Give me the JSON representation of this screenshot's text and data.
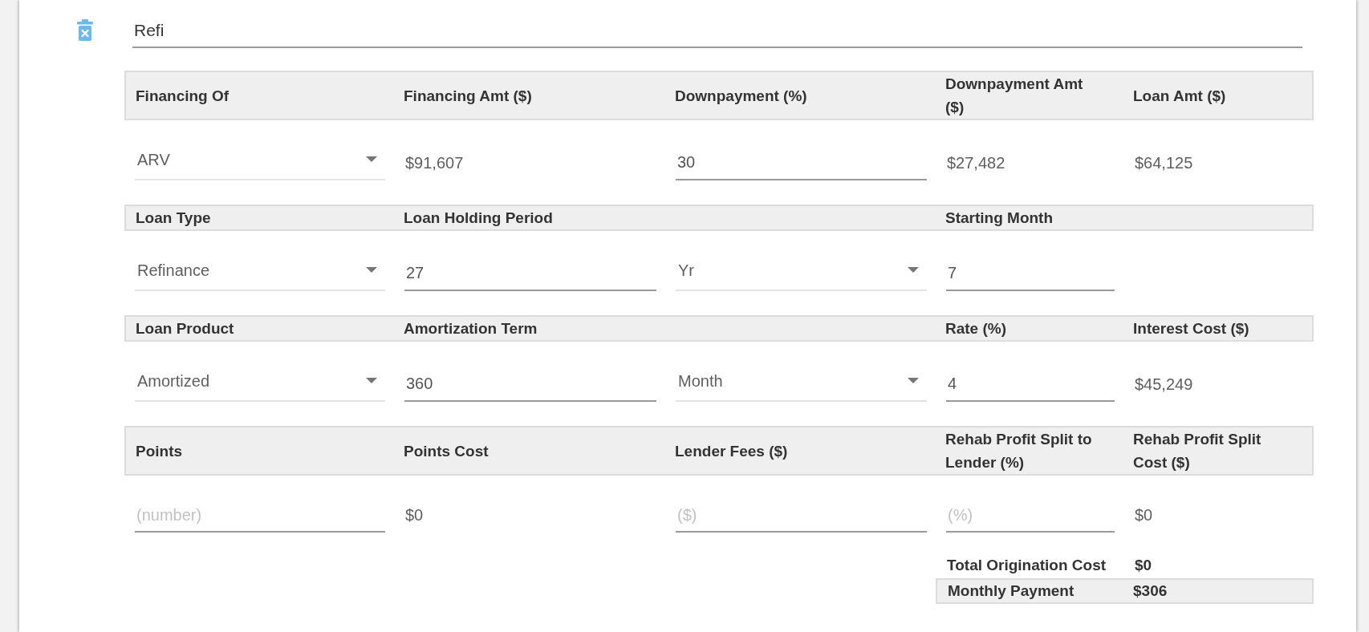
{
  "title_field": {
    "value": "Refi"
  },
  "sections": [
    {
      "cells": [
        {
          "header": "Financing Of",
          "field": {
            "kind": "select",
            "value": "ARV"
          }
        },
        {
          "header": "Financing Amt ($)",
          "field": {
            "kind": "text",
            "value": "$91,607"
          }
        },
        {
          "header": "Downpayment (%)",
          "field": {
            "kind": "input",
            "value": "30"
          }
        },
        {
          "header": "Downpayment Amt ($)",
          "field": {
            "kind": "text",
            "value": "$27,482"
          }
        },
        {
          "header": "Loan Amt ($)",
          "field": {
            "kind": "text",
            "value": "$64,125"
          }
        }
      ]
    },
    {
      "cells": [
        {
          "header": "Loan Type",
          "field": {
            "kind": "select",
            "value": "Refinance"
          }
        },
        {
          "header": "Loan Holding Period",
          "field": {
            "kind": "input",
            "value": "27"
          }
        },
        {
          "field": {
            "kind": "select",
            "value": "Yr"
          }
        },
        {
          "header": "Starting Month",
          "field": {
            "kind": "input",
            "value": "7"
          }
        }
      ]
    },
    {
      "cells": [
        {
          "header": "Loan Product",
          "field": {
            "kind": "select",
            "value": "Amortized"
          }
        },
        {
          "header": "Amortization Term",
          "field": {
            "kind": "input",
            "value": "360"
          }
        },
        {
          "field": {
            "kind": "select",
            "value": "Month"
          }
        },
        {
          "header": "Rate (%)",
          "field": {
            "kind": "input",
            "value": "4"
          }
        },
        {
          "header": "Interest Cost ($)",
          "field": {
            "kind": "text",
            "value": "$45,249"
          }
        }
      ]
    },
    {
      "cells": [
        {
          "header": "Points",
          "field": {
            "kind": "input",
            "placeholder": "(number)"
          }
        },
        {
          "header": "Points Cost",
          "field": {
            "kind": "text",
            "value": "$0"
          }
        },
        {
          "header": "Lender Fees ($)",
          "field": {
            "kind": "input",
            "placeholder": "($)"
          }
        },
        {
          "header": "Rehab Profit Split to Lender (%)",
          "field": {
            "kind": "input",
            "placeholder": "(%)"
          }
        },
        {
          "header": "Rehab Profit Split Cost ($)",
          "field": {
            "kind": "text",
            "value": "$0"
          }
        }
      ]
    }
  ],
  "summary": [
    {
      "kind": "plain",
      "label": "Total Origination Cost",
      "value": "$0"
    },
    {
      "kind": "boxed",
      "label": "Monthly Payment",
      "value": "$306"
    }
  ]
}
